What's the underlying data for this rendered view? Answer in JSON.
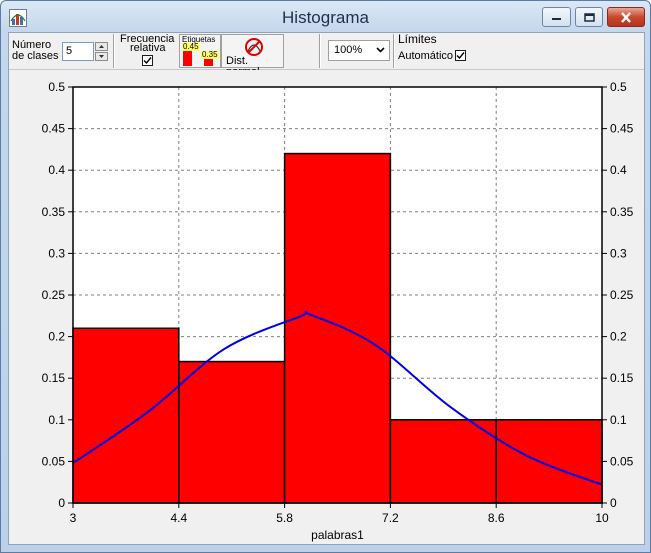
{
  "window": {
    "title": "Histograma",
    "icons": {
      "app": "histogram-app-icon",
      "minimize": "minimize-icon",
      "maximize": "maximize-icon",
      "close": "close-icon"
    }
  },
  "toolbar": {
    "num_classes_label_line1": "Número",
    "num_classes_label_line2": "de clases",
    "num_classes_value": "5",
    "freq_rel_line1": "Frecuencia",
    "freq_rel_line2": "relativa",
    "freq_rel_checked": true,
    "labels_button_text": "Etiquetas",
    "labels_icon_value_a": "0.45",
    "labels_icon_value_b": "0.35",
    "dist_normal_label": "Dist. normal",
    "zoom_value": "100%",
    "limits_label": "Límites",
    "auto_label": "Automático",
    "auto_checked": true
  },
  "colors": {
    "bar": "#ff0000",
    "curve": "#0000e6",
    "grid": "#808080"
  },
  "chart_data": {
    "type": "bar",
    "xlabel": "palabras1",
    "ylabel": "",
    "bins": [
      3,
      4.4,
      5.8,
      7.2,
      8.6,
      10
    ],
    "values": [
      0.21,
      0.17,
      0.42,
      0.1,
      0.1
    ],
    "ylim": [
      0,
      0.5
    ],
    "yticks": [
      "0",
      "0.05",
      "0.1",
      "0.15",
      "0.2",
      "0.25",
      "0.3",
      "0.35",
      "0.4",
      "0.45",
      "0.5"
    ],
    "xticks": [
      "3",
      "4.4",
      "5.8",
      "7.2",
      "8.6",
      "10"
    ],
    "grid": true,
    "normal_curve": {
      "x": [
        3,
        4,
        5,
        6,
        6.15,
        7,
        8,
        9,
        10
      ],
      "y": [
        0.048,
        0.11,
        0.185,
        0.224,
        0.226,
        0.19,
        0.115,
        0.057,
        0.022
      ]
    }
  }
}
